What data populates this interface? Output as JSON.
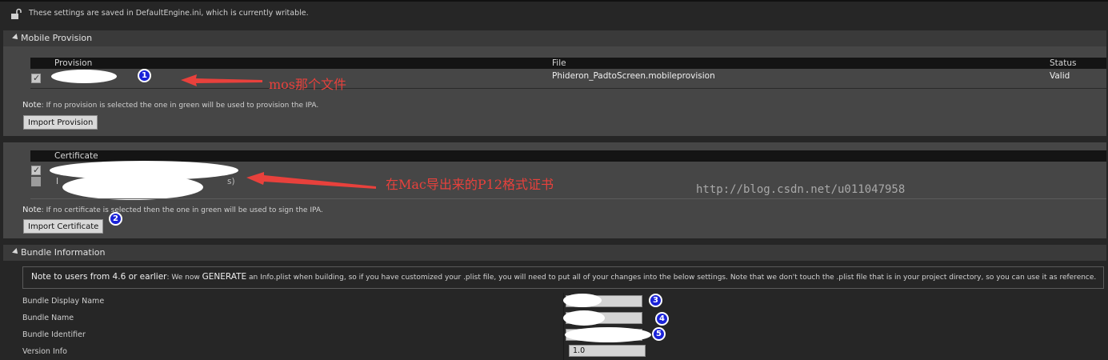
{
  "lock_notice": {
    "text": "These settings are saved in DefaultEngine.ini, which is currently writable."
  },
  "sections": {
    "mobile_provision": "Mobile Provision",
    "bundle_information": "Bundle Information"
  },
  "provision_table": {
    "columns": [
      "Provision",
      "File",
      "Status"
    ],
    "rows": [
      {
        "checked": true,
        "provision": "",
        "file": "Phideron_PadtoScreen.mobileprovision",
        "status": "Valid"
      }
    ]
  },
  "provision_note": {
    "prefix": "Note",
    "text": ": If no provision is selected the one in green will be used to provision the IPA."
  },
  "import_provision_label": "Import Provision",
  "certificate_table": {
    "columns": [
      "Certificate"
    ],
    "rows": [
      {
        "checked": true,
        "name": ""
      },
      {
        "checked": false,
        "name": "I",
        "tail": "s)"
      }
    ]
  },
  "certificate_note": {
    "prefix": "Note",
    "text": ": If no certificate is selected then the one in green will be used to sign the IPA."
  },
  "import_certificate_label": "Import Certificate",
  "annotations": {
    "arrow1_text": "mos那个文件",
    "arrow2_text": "在Mac导出来的P12格式证书",
    "watermark": "http://blog.csdn.net/u011047958",
    "badges": [
      "1",
      "2",
      "3",
      "4",
      "5"
    ]
  },
  "bundle_note": {
    "prefix": "Note to users from 4.6 or earlier",
    "text_a": ": We now ",
    "generate": "GENERATE",
    "text_b": " an Info.plist when building, so if you have customized your .plist file, you will need to put all of your changes into the below settings. Note that we don't touch the .plist file that is in your project directory, so you can use it as reference."
  },
  "bundle_fields": [
    {
      "label": "Bundle Display Name",
      "value": ""
    },
    {
      "label": "Bundle Name",
      "value": ""
    },
    {
      "label": "Bundle Identifier",
      "value": ""
    },
    {
      "label": "Version Info",
      "value": "1.0"
    }
  ],
  "colors": {
    "annotation_red": "#e8413c",
    "badge_blue": "#1a22d8",
    "panel": "#464646",
    "background": "#262626"
  }
}
